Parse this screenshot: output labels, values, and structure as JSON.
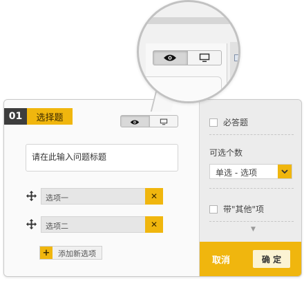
{
  "question": {
    "number": "01",
    "type_label": "选择题",
    "title_placeholder": "请在此输入问题标题",
    "options": [
      {
        "label": "选项一"
      },
      {
        "label": "选项二"
      }
    ],
    "add_option_label": "添加新选项"
  },
  "settings": {
    "required_label": "必答题",
    "choice_count_label": "可选个数",
    "choice_count_value": "单选 - 选项",
    "other_option_label": "带\"其他\"项"
  },
  "footer": {
    "cancel_label": "取消",
    "ok_label": "确 定"
  },
  "icons": {
    "preview": "eye-icon",
    "desktop": "monitor-icon",
    "drag": "move-icon",
    "delete": "close-icon",
    "add": "plus-icon",
    "dropdown": "chevron-down-icon"
  },
  "colors": {
    "accent": "#f0b60e",
    "number_bg": "#3d3d3d"
  }
}
